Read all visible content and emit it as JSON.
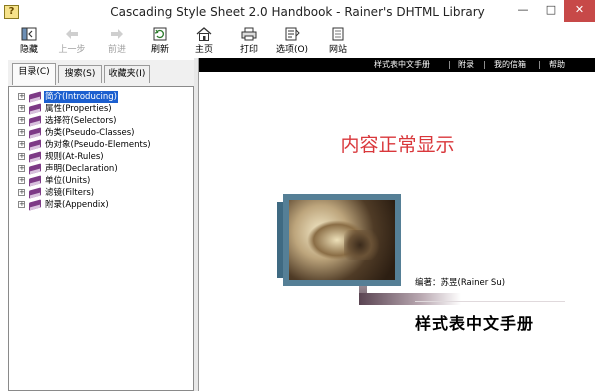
{
  "window": {
    "title": "Cascading Style Sheet 2.0 Handbook - Rainer's DHTML Library",
    "app_icon_glyph": "?",
    "minimize_glyph": "—",
    "maximize_glyph": "□",
    "close_glyph": "✕"
  },
  "toolbar": {
    "buttons": [
      {
        "label": "隐藏",
        "icon": "hide-pane-icon",
        "enabled": true
      },
      {
        "label": "上一步",
        "icon": "back-arrow-icon",
        "enabled": false
      },
      {
        "label": "前进",
        "icon": "forward-arrow-icon",
        "enabled": false
      },
      {
        "label": "刷新",
        "icon": "refresh-icon",
        "enabled": true
      },
      {
        "label": "主页",
        "icon": "home-icon",
        "enabled": true
      },
      {
        "label": "打印",
        "icon": "print-icon",
        "enabled": true
      },
      {
        "label": "选项(O)",
        "icon": "options-icon",
        "enabled": true
      },
      {
        "label": "网站",
        "icon": "website-icon",
        "enabled": true
      }
    ]
  },
  "navigation": {
    "tabs": [
      {
        "label": "目录(C)",
        "active": true
      },
      {
        "label": "搜索(S)",
        "active": false
      },
      {
        "label": "收藏夹(I)",
        "active": false
      }
    ],
    "expander_glyph": "+",
    "tree": [
      {
        "label": "简介(Introducing)",
        "selected": true
      },
      {
        "label": "属性(Properties)",
        "selected": false
      },
      {
        "label": "选择符(Selectors)",
        "selected": false
      },
      {
        "label": "伪类(Pseudo-Classes)",
        "selected": false
      },
      {
        "label": "伪对象(Pseudo-Elements)",
        "selected": false
      },
      {
        "label": "规则(At-Rules)",
        "selected": false
      },
      {
        "label": "声明(Declaration)",
        "selected": false
      },
      {
        "label": "单位(Units)",
        "selected": false
      },
      {
        "label": "滤镜(Filters)",
        "selected": false
      },
      {
        "label": "附录(Appendix)",
        "selected": false
      }
    ]
  },
  "content": {
    "top_links": [
      "样式表中文手册",
      "附录",
      "我的信箱",
      "帮助"
    ],
    "link_separator": "|",
    "headline": "内容正常显示",
    "author": "编著：苏昱(Rainer Su)",
    "book_title": "样式表中文手册",
    "colors": {
      "headline": "#d9373b",
      "selection": "#1c5fcf",
      "close_button": "#c74948",
      "top_nav_bar": "#000000"
    }
  }
}
